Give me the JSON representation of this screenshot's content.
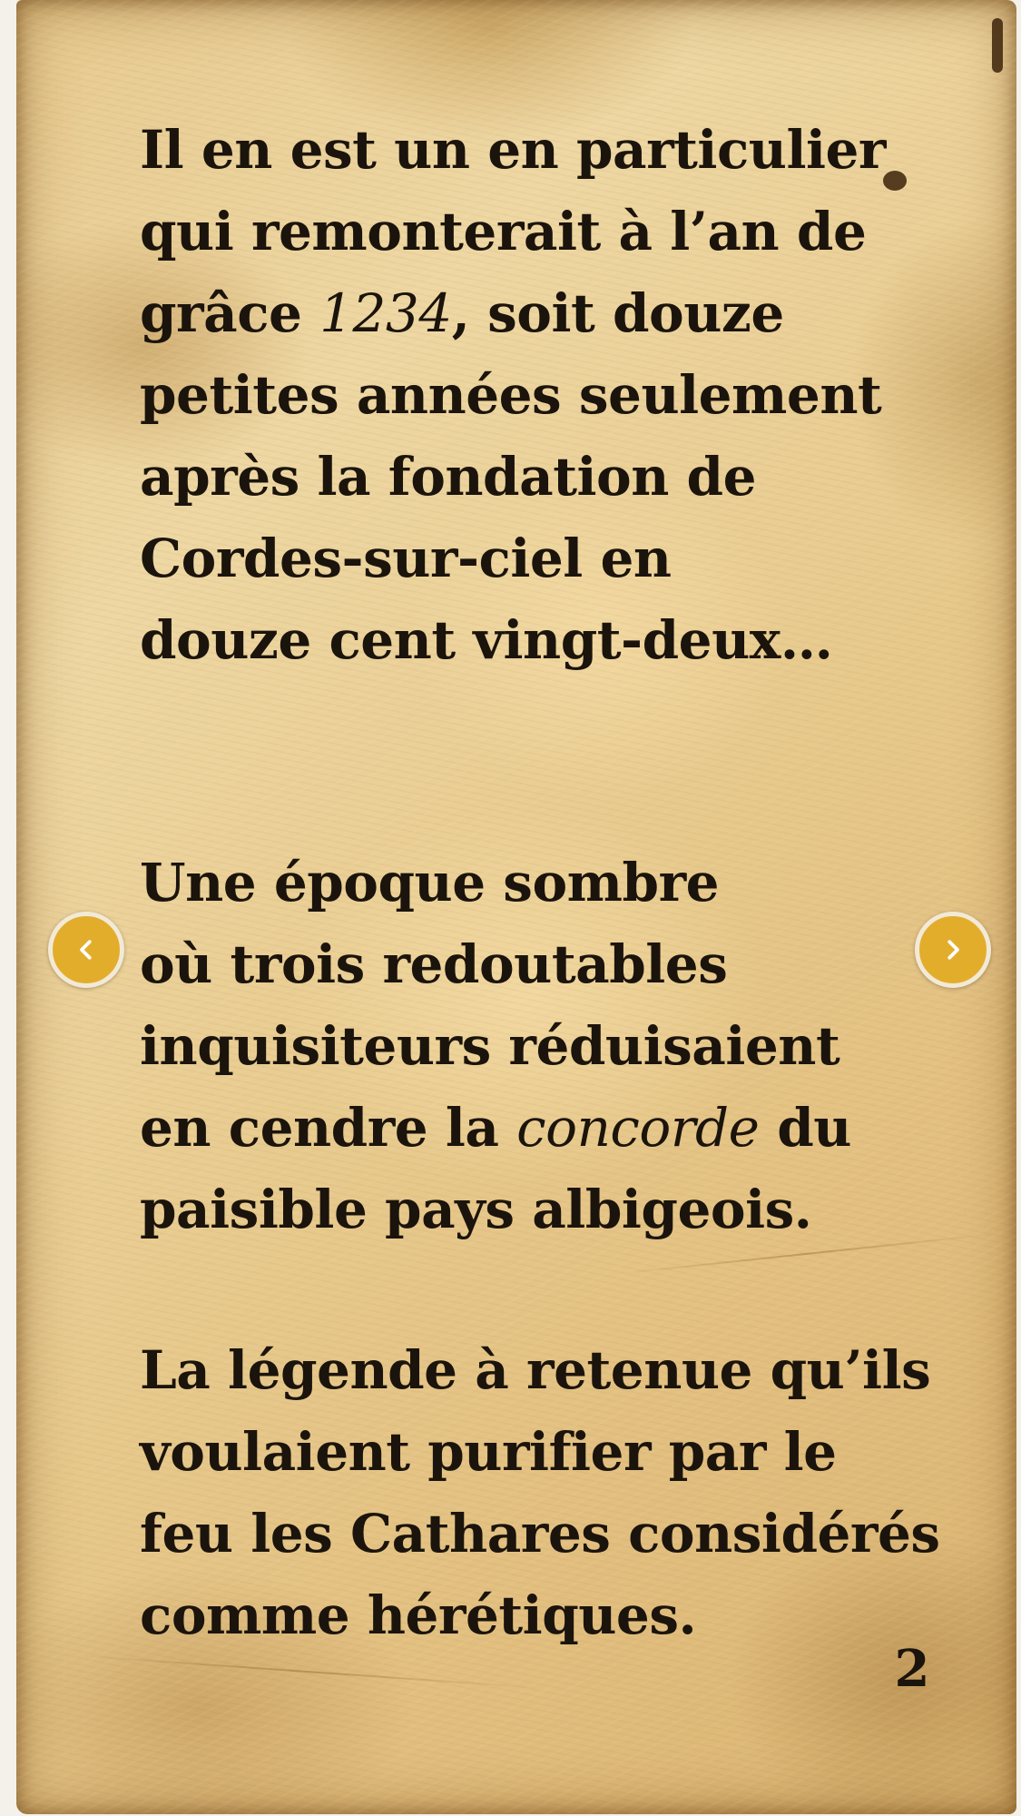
{
  "page": {
    "paragraph_1": {
      "lines": [
        "Il en est un en particulier",
        "qui remonterait à l’an de",
        "grâce",
        "1234",
        ", soit douze",
        "petites années seulement",
        "après la fondation de",
        "Cordes-sur-ciel en",
        "douze cent vingt-deux…"
      ]
    },
    "paragraph_2": {
      "lines": [
        "Une époque sombre",
        "où trois redoutables",
        "inquisiteurs réduisaient",
        "en cendre la",
        "concorde",
        "du",
        "paisible pays albigeois."
      ]
    },
    "paragraph_3": {
      "lines": [
        "La légende à retenue qu’ils",
        "voulaient purifier par le",
        "feu les Cathares considérés",
        "comme hérétiques."
      ]
    },
    "page_number": "2"
  },
  "navigation": {
    "previous_icon": "chevron-left-icon",
    "next_icon": "chevron-right-icon",
    "accent_color": "#e3ad2c"
  },
  "theme": {
    "text_color": "#1b140c",
    "paper_color": "#e8cb8f"
  }
}
